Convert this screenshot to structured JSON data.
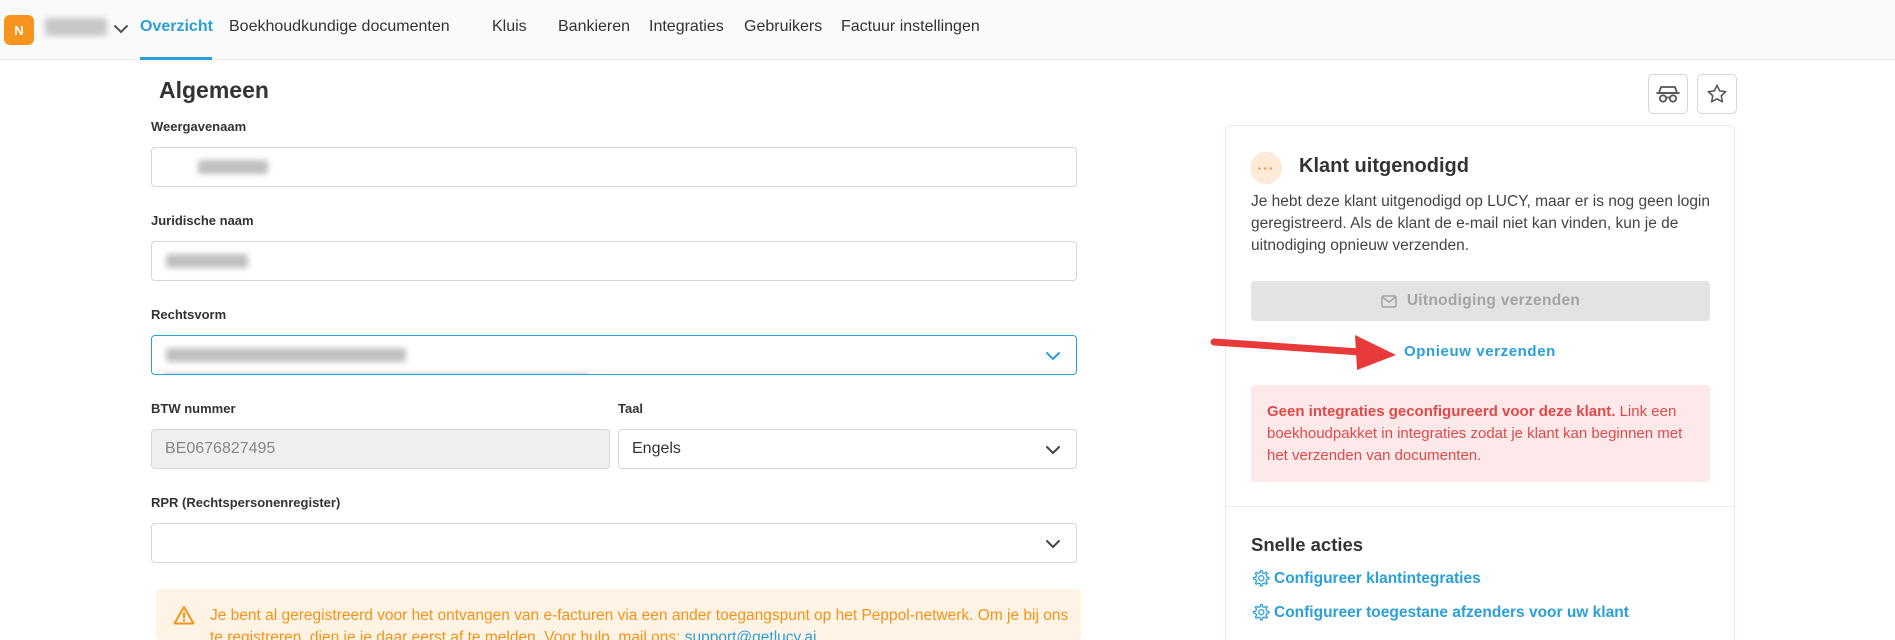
{
  "nav": {
    "avatar_letter": "N",
    "tabs": [
      {
        "label": "Overzicht",
        "active": true
      },
      {
        "label": "Boekhoudkundige documenten"
      },
      {
        "label": "Kluis"
      },
      {
        "label": "Bankieren"
      },
      {
        "label": "Integraties"
      },
      {
        "label": "Gebruikers"
      },
      {
        "label": "Factuur instellingen"
      }
    ]
  },
  "form": {
    "title": "Algemeen",
    "weergavenaam_label": "Weergavenaam",
    "juridische_naam_label": "Juridische naam",
    "rechtsvorm_label": "Rechtsvorm",
    "btw_label": "BTW nummer",
    "btw_value": "BE0676827495",
    "taal_label": "Taal",
    "taal_value": "Engels",
    "rpr_label": "RPR (Rechtspersonenregister)",
    "rpr_value": "",
    "warning_text": "Je bent al geregistreerd voor het ontvangen van e-facturen via een ander toegangspunt op het Peppol-netwerk. Om je bij ons te registreren, dien je je daar eerst af te melden. Voor hulp, mail ons: ",
    "warning_email": "support@getlucy.ai"
  },
  "header_buttons": {
    "incognito_icon": "incognito-icon",
    "favorite_icon": "star-icon"
  },
  "card": {
    "status_icon": "···",
    "title": "Klant uitgenodigd",
    "description": "Je hebt deze klant uitgenodigd op LUCY, maar er is nog geen login geregistreerd. Als de klant de e-mail niet kan vinden, kun je de uitnodiging opnieuw verzenden.",
    "invite_button": "Uitnodiging verzenden",
    "resend_link": "Opnieuw verzenden",
    "error_bold": "Geen integraties geconfigureerd voor deze klant.",
    "error_text": " Link een boekhoudpakket in integraties zodat je klant kan beginnen met het verzenden van documenten.",
    "quick_actions_title": "Snelle acties",
    "quick_actions": [
      {
        "label": "Configureer klantintegraties"
      },
      {
        "label": "Configureer toegestane afzenders voor uw klant"
      }
    ]
  },
  "colors": {
    "accent": "#2a9fd8",
    "avatar": "#f7941d",
    "warning_text": "#f39318",
    "warning_bg": "#fff3e6",
    "error_text": "#e0494a",
    "error_bg": "#fde9e9",
    "annotation_arrow": "#e8393b"
  }
}
